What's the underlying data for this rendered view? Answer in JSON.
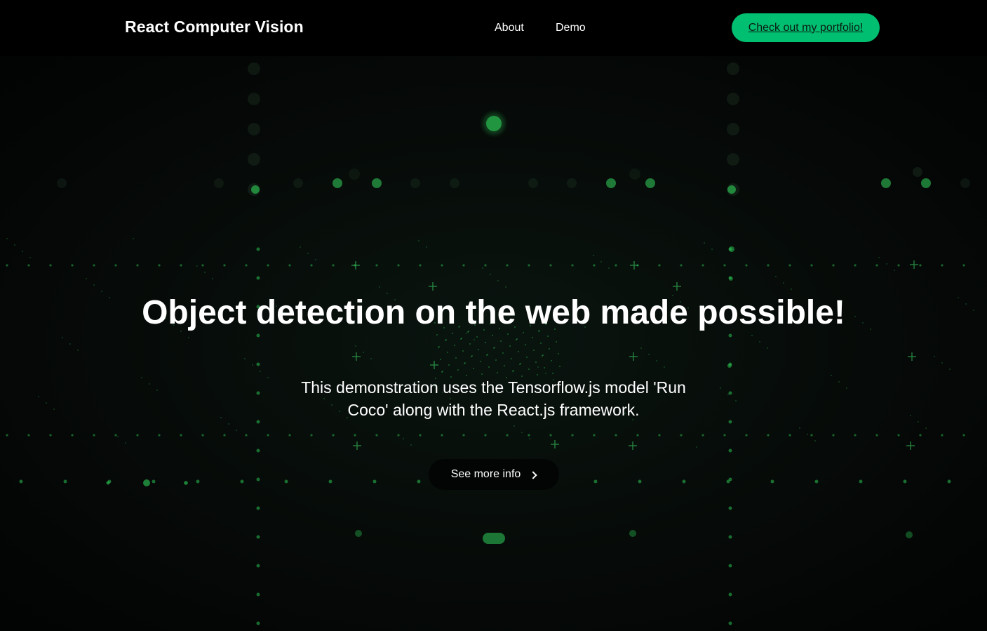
{
  "navbar": {
    "logo": "React Computer Vision",
    "links": [
      "About",
      "Demo"
    ],
    "portfolio_button": "Check out my portfolio!"
  },
  "hero": {
    "title": "Object detection on the web made possible!",
    "description": "This demonstration uses the Tensorflow.js model 'Run Coco' along with the React.js framework.",
    "see_more_button": "See more info"
  },
  "colors": {
    "accent": "#01bf71",
    "background": "#000000"
  },
  "icons": {
    "see_more": "chevron-right-icon"
  }
}
